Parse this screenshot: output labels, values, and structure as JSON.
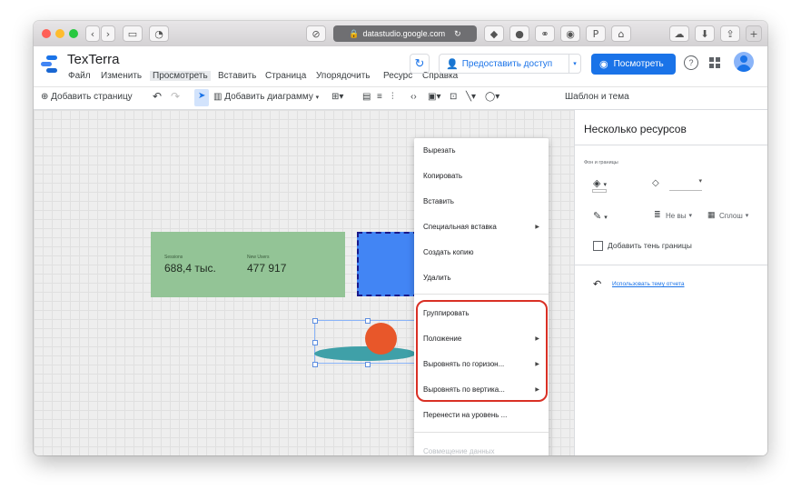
{
  "browser": {
    "url": "datastudio.google.com"
  },
  "app": {
    "title": "TexTerra",
    "menu": [
      "Файл",
      "Изменить",
      "Просмотреть",
      "Вставить",
      "Страница",
      "Упорядочить",
      "Ресурс",
      "Справка"
    ],
    "share_label": "Предоставить доступ",
    "view_label": "Посмотреть"
  },
  "toolbar": {
    "add_page": "Добавить страницу",
    "add_chart": "Добавить диаграмму",
    "theme": "Шаблон и тема"
  },
  "scorecards": [
    {
      "label": "Sessions",
      "value": "688,4 тыс."
    },
    {
      "label": "New Users",
      "value": "477 917"
    }
  ],
  "context_menu": {
    "items": [
      {
        "label": "Вырезать",
        "has_submenu": false
      },
      {
        "label": "Копировать",
        "has_submenu": false
      },
      {
        "label": "Вставить",
        "has_submenu": false
      },
      {
        "label": "Специальная вставка",
        "has_submenu": true
      },
      {
        "label": "Создать копию",
        "has_submenu": false
      },
      {
        "label": "Удалить",
        "has_submenu": false
      },
      {
        "label": "Группировать",
        "has_submenu": false
      },
      {
        "label": "Положение",
        "has_submenu": true
      },
      {
        "label": "Выровнять по горизон...",
        "has_submenu": true
      },
      {
        "label": "Выровнять по вертика...",
        "has_submenu": true
      },
      {
        "label": "Перенести на уровень ...",
        "has_submenu": false
      },
      {
        "label": "Совмещение данных",
        "has_submenu": false,
        "disabled": true
      }
    ],
    "highlight_color": "#d93025"
  },
  "panel": {
    "title": "Несколько ресурсов",
    "section": "Фон и границы",
    "border_weight": "Не вы",
    "border_style": "Сплош",
    "shadow_label": "Добавить тень границы",
    "theme_link": "Использовать тему отчета"
  },
  "colors": {
    "accent": "#1a73e8",
    "green_card": "#93c496",
    "blue_shape": "#4285f4",
    "orange_circle": "#e8572a",
    "teal_ellipse": "#3fa0a8"
  }
}
